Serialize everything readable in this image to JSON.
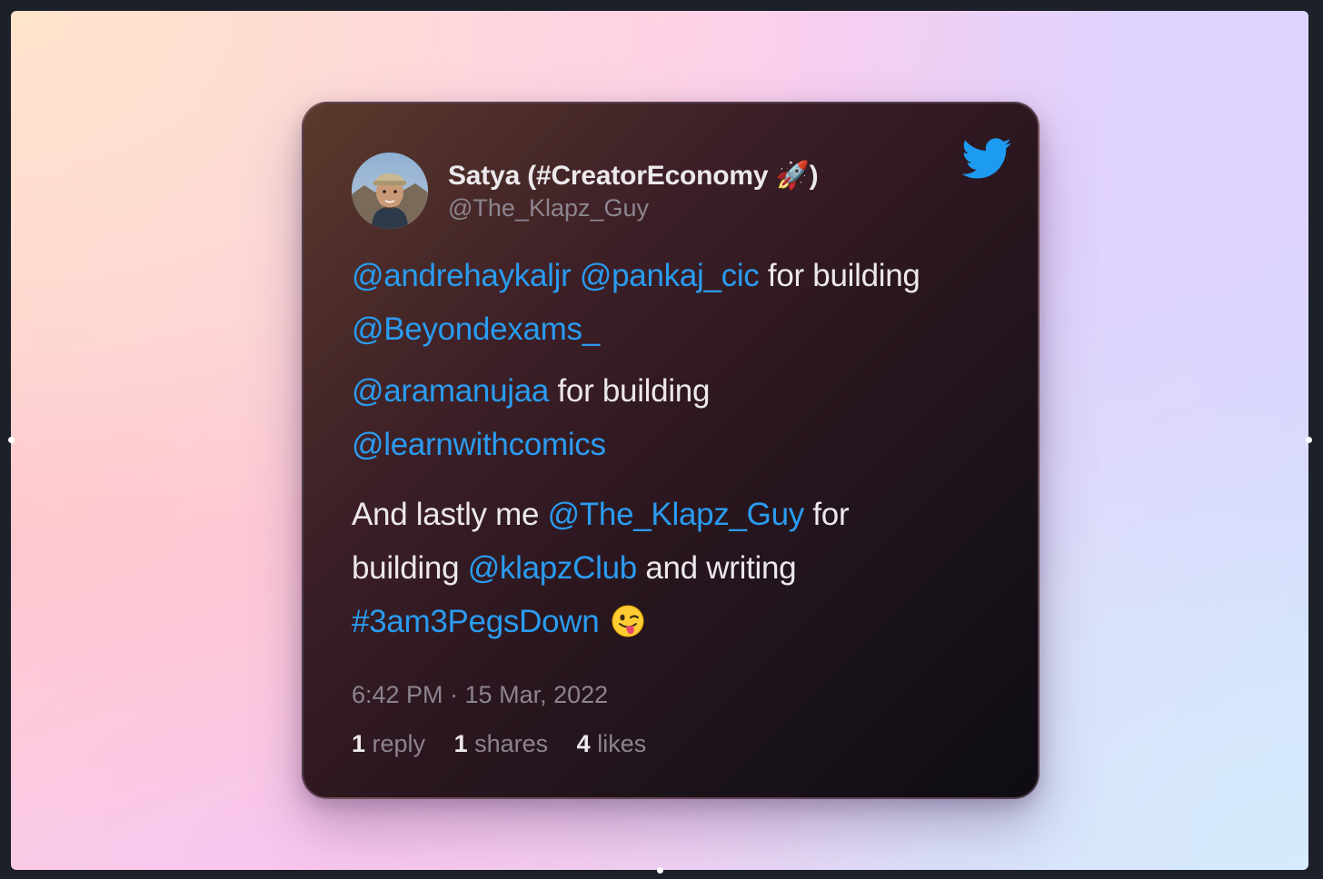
{
  "tweet": {
    "author_name": "Satya (#CreatorEconomy 🚀)",
    "author_handle": "@The_Klapz_Guy",
    "lines": {
      "l1_m1": "@andrehaykaljr",
      "l1_m2": "@pankaj_cic",
      "l1_t1": " for building",
      "l2_m1": "@Beyondexams_",
      "l3_m1": "@aramanujaa",
      "l3_t1": " for building",
      "l4_m1": "@learnwithcomics",
      "l5_t1": "And lastly me ",
      "l5_m1": "@The_Klapz_Guy",
      "l5_t2": " for",
      "l6_t1": "building ",
      "l6_m1": "@klapzClub",
      "l6_t2": " and writing",
      "l7_h1": "#3am3PegsDown"
    },
    "emoji": "winking-tongue-emoji",
    "timestamp": "6:42 PM · 15 Mar, 2022",
    "stats": {
      "replies_count": "1",
      "replies_label": " reply",
      "shares_count": "1",
      "shares_label": " shares",
      "likes_count": "4",
      "likes_label": " likes"
    },
    "icon": "twitter-bird-icon"
  },
  "colors": {
    "link": "#2a9cf0",
    "text": "#ece8ec",
    "muted": "#8c8490",
    "twitter_blue": "#1d9bf0"
  }
}
